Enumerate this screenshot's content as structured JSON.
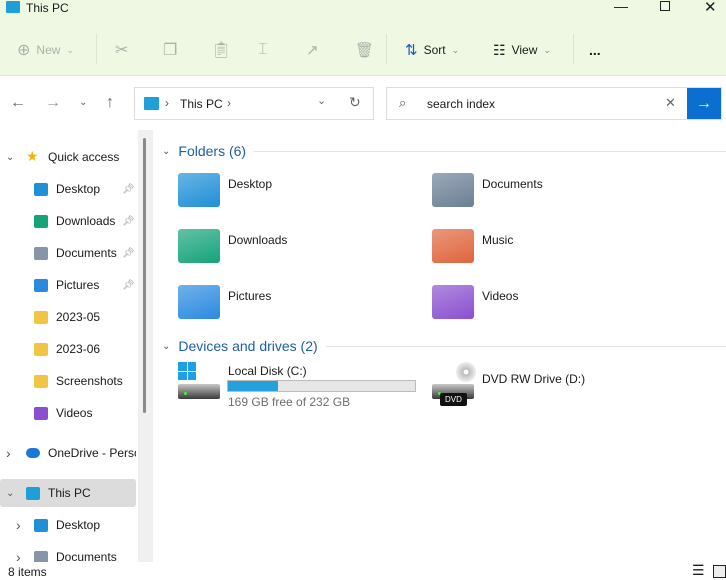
{
  "window": {
    "title": "This PC",
    "controls": [
      "minimize",
      "maximize",
      "close"
    ]
  },
  "toolbar": {
    "new_label": "New",
    "sort_label": "Sort",
    "view_label": "View",
    "more": "..."
  },
  "address": {
    "crumbs": [
      "This PC"
    ]
  },
  "search": {
    "value": "search index"
  },
  "sidebar": {
    "items": [
      {
        "label": "Quick access",
        "icon": "star-icon",
        "level": 0,
        "expanded": true
      },
      {
        "label": "Desktop",
        "icon": "desktop-folder-icon",
        "level": 1,
        "pinned": true
      },
      {
        "label": "Downloads",
        "icon": "download-icon",
        "level": 1,
        "pinned": true
      },
      {
        "label": "Documents",
        "icon": "document-icon",
        "level": 1,
        "pinned": true
      },
      {
        "label": "Pictures",
        "icon": "pictures-icon",
        "level": 1,
        "pinned": true
      },
      {
        "label": "2023-05",
        "icon": "folder-icon",
        "level": 1
      },
      {
        "label": "2023-06",
        "icon": "folder-icon",
        "level": 1
      },
      {
        "label": "Screenshots",
        "icon": "folder-icon",
        "level": 1
      },
      {
        "label": "Videos",
        "icon": "videos-icon",
        "level": 1
      },
      {
        "label": "OneDrive - Perso",
        "icon": "cloud-icon",
        "level": 0,
        "expanded": false
      },
      {
        "label": "This PC",
        "icon": "computer-icon",
        "level": 0,
        "expanded": true,
        "selected": true
      },
      {
        "label": "Desktop",
        "icon": "desktop-folder-icon",
        "level": 1,
        "expanded": false
      },
      {
        "label": "Documents",
        "icon": "document-icon",
        "level": 1,
        "expanded": false
      }
    ]
  },
  "main": {
    "folders_header": "Folders (6)",
    "folders": [
      {
        "label": "Desktop",
        "color": "#1f8fd6"
      },
      {
        "label": "Documents",
        "color": "#6b7f95"
      },
      {
        "label": "Downloads",
        "color": "#15a37a"
      },
      {
        "label": "Music",
        "color": "#e0643c"
      },
      {
        "label": "Pictures",
        "color": "#2a8ae0"
      },
      {
        "label": "Videos",
        "color": "#8a4fd0"
      }
    ],
    "drives_header": "Devices and drives (2)",
    "drives": [
      {
        "label": "Local Disk (C:)",
        "free_text": "169 GB free of 232 GB",
        "used_fraction": 0.27
      },
      {
        "label": "DVD RW Drive (D:)",
        "badge": "DVD"
      }
    ]
  },
  "status": {
    "items": "8 items"
  },
  "colors": {
    "accent": "#0a6fd1",
    "bar_fill": "#26a0da",
    "ribbon": "#eef8e3"
  }
}
